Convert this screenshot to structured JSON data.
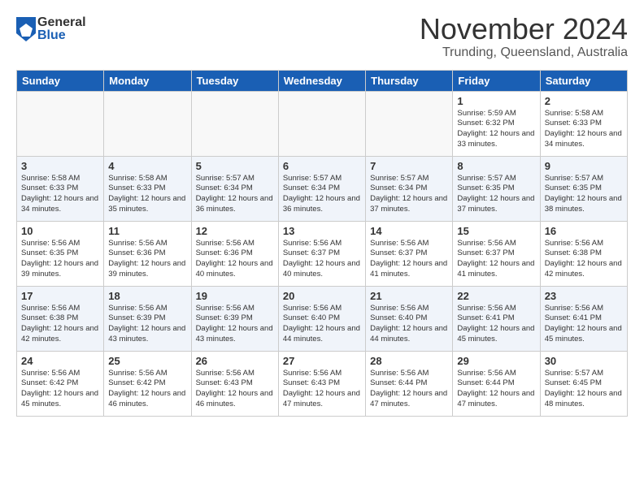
{
  "logo": {
    "general": "General",
    "blue": "Blue"
  },
  "title": "November 2024",
  "location": "Trunding, Queensland, Australia",
  "days_of_week": [
    "Sunday",
    "Monday",
    "Tuesday",
    "Wednesday",
    "Thursday",
    "Friday",
    "Saturday"
  ],
  "weeks": [
    [
      {
        "day": "",
        "info": ""
      },
      {
        "day": "",
        "info": ""
      },
      {
        "day": "",
        "info": ""
      },
      {
        "day": "",
        "info": ""
      },
      {
        "day": "",
        "info": ""
      },
      {
        "day": "1",
        "info": "Sunrise: 5:59 AM\nSunset: 6:32 PM\nDaylight: 12 hours and 33 minutes."
      },
      {
        "day": "2",
        "info": "Sunrise: 5:58 AM\nSunset: 6:33 PM\nDaylight: 12 hours and 34 minutes."
      }
    ],
    [
      {
        "day": "3",
        "info": "Sunrise: 5:58 AM\nSunset: 6:33 PM\nDaylight: 12 hours and 34 minutes."
      },
      {
        "day": "4",
        "info": "Sunrise: 5:58 AM\nSunset: 6:33 PM\nDaylight: 12 hours and 35 minutes."
      },
      {
        "day": "5",
        "info": "Sunrise: 5:57 AM\nSunset: 6:34 PM\nDaylight: 12 hours and 36 minutes."
      },
      {
        "day": "6",
        "info": "Sunrise: 5:57 AM\nSunset: 6:34 PM\nDaylight: 12 hours and 36 minutes."
      },
      {
        "day": "7",
        "info": "Sunrise: 5:57 AM\nSunset: 6:34 PM\nDaylight: 12 hours and 37 minutes."
      },
      {
        "day": "8",
        "info": "Sunrise: 5:57 AM\nSunset: 6:35 PM\nDaylight: 12 hours and 37 minutes."
      },
      {
        "day": "9",
        "info": "Sunrise: 5:57 AM\nSunset: 6:35 PM\nDaylight: 12 hours and 38 minutes."
      }
    ],
    [
      {
        "day": "10",
        "info": "Sunrise: 5:56 AM\nSunset: 6:35 PM\nDaylight: 12 hours and 39 minutes."
      },
      {
        "day": "11",
        "info": "Sunrise: 5:56 AM\nSunset: 6:36 PM\nDaylight: 12 hours and 39 minutes."
      },
      {
        "day": "12",
        "info": "Sunrise: 5:56 AM\nSunset: 6:36 PM\nDaylight: 12 hours and 40 minutes."
      },
      {
        "day": "13",
        "info": "Sunrise: 5:56 AM\nSunset: 6:37 PM\nDaylight: 12 hours and 40 minutes."
      },
      {
        "day": "14",
        "info": "Sunrise: 5:56 AM\nSunset: 6:37 PM\nDaylight: 12 hours and 41 minutes."
      },
      {
        "day": "15",
        "info": "Sunrise: 5:56 AM\nSunset: 6:37 PM\nDaylight: 12 hours and 41 minutes."
      },
      {
        "day": "16",
        "info": "Sunrise: 5:56 AM\nSunset: 6:38 PM\nDaylight: 12 hours and 42 minutes."
      }
    ],
    [
      {
        "day": "17",
        "info": "Sunrise: 5:56 AM\nSunset: 6:38 PM\nDaylight: 12 hours and 42 minutes."
      },
      {
        "day": "18",
        "info": "Sunrise: 5:56 AM\nSunset: 6:39 PM\nDaylight: 12 hours and 43 minutes."
      },
      {
        "day": "19",
        "info": "Sunrise: 5:56 AM\nSunset: 6:39 PM\nDaylight: 12 hours and 43 minutes."
      },
      {
        "day": "20",
        "info": "Sunrise: 5:56 AM\nSunset: 6:40 PM\nDaylight: 12 hours and 44 minutes."
      },
      {
        "day": "21",
        "info": "Sunrise: 5:56 AM\nSunset: 6:40 PM\nDaylight: 12 hours and 44 minutes."
      },
      {
        "day": "22",
        "info": "Sunrise: 5:56 AM\nSunset: 6:41 PM\nDaylight: 12 hours and 45 minutes."
      },
      {
        "day": "23",
        "info": "Sunrise: 5:56 AM\nSunset: 6:41 PM\nDaylight: 12 hours and 45 minutes."
      }
    ],
    [
      {
        "day": "24",
        "info": "Sunrise: 5:56 AM\nSunset: 6:42 PM\nDaylight: 12 hours and 45 minutes."
      },
      {
        "day": "25",
        "info": "Sunrise: 5:56 AM\nSunset: 6:42 PM\nDaylight: 12 hours and 46 minutes."
      },
      {
        "day": "26",
        "info": "Sunrise: 5:56 AM\nSunset: 6:43 PM\nDaylight: 12 hours and 46 minutes."
      },
      {
        "day": "27",
        "info": "Sunrise: 5:56 AM\nSunset: 6:43 PM\nDaylight: 12 hours and 47 minutes."
      },
      {
        "day": "28",
        "info": "Sunrise: 5:56 AM\nSunset: 6:44 PM\nDaylight: 12 hours and 47 minutes."
      },
      {
        "day": "29",
        "info": "Sunrise: 5:56 AM\nSunset: 6:44 PM\nDaylight: 12 hours and 47 minutes."
      },
      {
        "day": "30",
        "info": "Sunrise: 5:57 AM\nSunset: 6:45 PM\nDaylight: 12 hours and 48 minutes."
      }
    ]
  ]
}
